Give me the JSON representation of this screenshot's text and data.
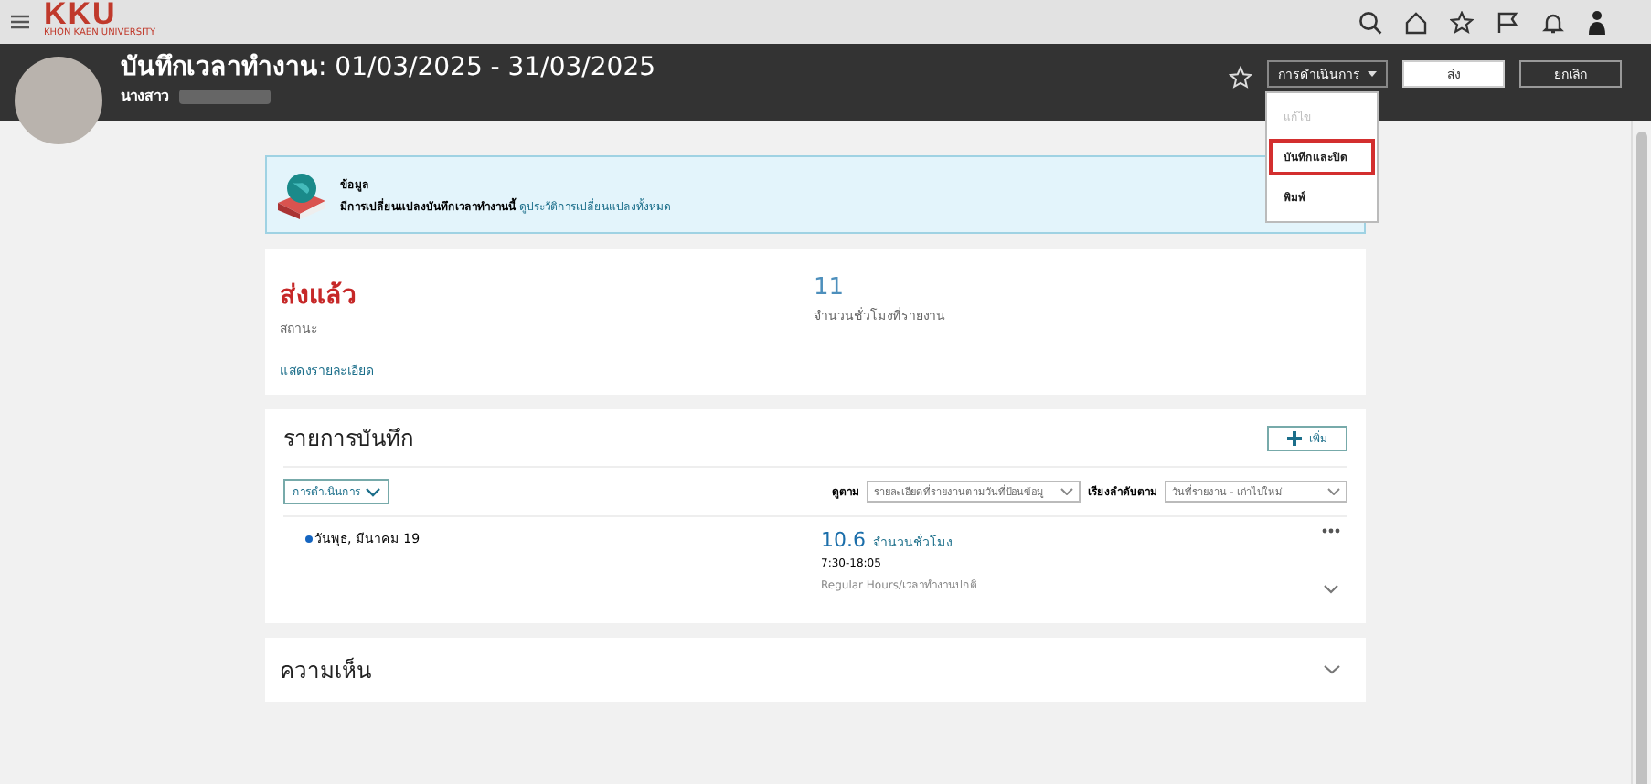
{
  "logo": {
    "mark": "KKU",
    "subtitle": "KHON KAEN UNIVERSITY"
  },
  "header": {
    "title_label": "บันทึกเวลาทำงาน",
    "title_range": ": 01/03/2025 - 31/03/2025",
    "person_prefix": "นางสาว",
    "favorite": false,
    "actions_button": "การดำเนินการ",
    "submit_button": "ส่ง",
    "cancel_button": "ยกเลิก"
  },
  "actions_menu": [
    {
      "label": "แก้ไข",
      "disabled": true,
      "selected": false
    },
    {
      "label": "บันทึกและปิด",
      "disabled": false,
      "selected": true
    },
    {
      "label": "พิมพ์",
      "disabled": false,
      "selected": false
    }
  ],
  "info": {
    "title": "ข้อมูล",
    "message": "มีการเปลี่ยนแปลงบันทึกเวลาทำงานนี้",
    "link": "ดูประวัติการเปลี่ยนแปลงทั้งหมด"
  },
  "summary": {
    "status": "ส่งแล้ว",
    "status_label": "สถานะ",
    "hours": "11",
    "hours_label": "จำนวนชั่วโมงที่รายงาน",
    "details_link": "แสดงรายละเอียด"
  },
  "entries": {
    "title": "รายการบันทึก",
    "add_button": "เพิ่ม",
    "actions_button": "การดำเนินการ",
    "view_label": "ดูตาม",
    "view_value": "รายละเอียดที่รายงานตามวันที่ป้อนข้อมู",
    "sort_label": "เรียงลำดับตาม",
    "sort_value": "วันที่รายงาน - เก่าไปใหม่",
    "rows": [
      {
        "date": "วันพุธ, มีนาคม 19",
        "color": "#1565c0",
        "hours": "10.6",
        "hours_label": "จำนวนชั่วโมง",
        "time": "7:30-18:05",
        "type": "Regular Hours/เวลาทำงานปกติ",
        "expanded": false
      }
    ]
  },
  "comments": {
    "title": "ความเห็น",
    "expanded": false
  }
}
